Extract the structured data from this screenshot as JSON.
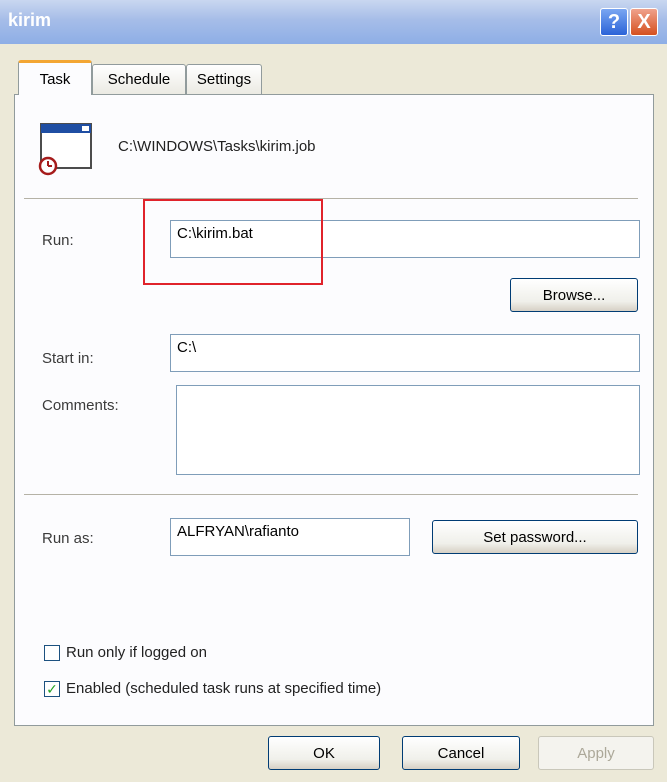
{
  "window": {
    "title": "kirim",
    "help_glyph": "?",
    "close_glyph": "X"
  },
  "tabs": [
    {
      "label": "Task",
      "active": true
    },
    {
      "label": "Schedule",
      "active": false
    },
    {
      "label": "Settings",
      "active": false
    }
  ],
  "task": {
    "job_path": "C:\\WINDOWS\\Tasks\\kirim.job",
    "run_label": "Run:",
    "run_value": "C:\\kirim.bat",
    "browse_label": "Browse...",
    "start_in_label": "Start in:",
    "start_in_value": "C:\\",
    "comments_label": "Comments:",
    "comments_value": "",
    "run_as_label": "Run as:",
    "run_as_value": "ALFRYAN\\rafianto",
    "set_password_label": "Set password...",
    "run_only_logged_on_label": "Run only if logged on",
    "run_only_logged_on_checked": false,
    "enabled_label": "Enabled (scheduled task runs at specified time)",
    "enabled_checked": true
  },
  "footer": {
    "ok_label": "OK",
    "cancel_label": "Cancel",
    "apply_label": "Apply"
  },
  "colors": {
    "highlight": "#e0232b",
    "accent_tab": "#f3a633"
  }
}
